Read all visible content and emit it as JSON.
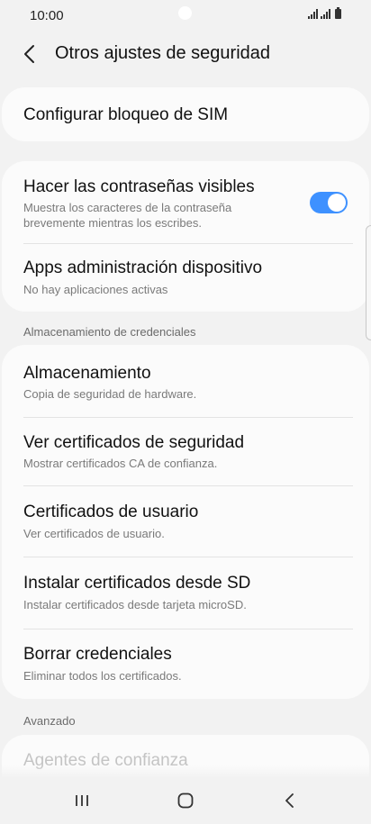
{
  "status_bar": {
    "time": "10:00"
  },
  "header": {
    "title": "Otros ajustes de seguridad",
    "back_icon": "chevron-left-icon"
  },
  "cards": {
    "sim": {
      "title": "Configurar bloqueo de SIM"
    },
    "passwords": {
      "title": "Hacer las contraseñas visibles",
      "subtitle_line1": "Muestra los caracteres de la contraseña",
      "subtitle_line2": "brevemente mientras los escribes.",
      "toggle_on": true
    },
    "device_admin": {
      "title": "Apps administración dispositivo",
      "subtitle": "No hay aplicaciones activas"
    }
  },
  "credentials_section": {
    "label": "Almacenamiento de credenciales",
    "items": [
      {
        "title": "Almacenamiento",
        "subtitle": "Copia de seguridad de hardware."
      },
      {
        "title": "Ver certificados de seguridad",
        "subtitle": "Mostrar certificados CA de confianza."
      },
      {
        "title": "Certificados de usuario",
        "subtitle": "Ver certificados de usuario."
      },
      {
        "title": "Instalar certificados desde SD",
        "subtitle": "Instalar certificados desde tarjeta microSD."
      },
      {
        "title": "Borrar credenciales",
        "subtitle": "Eliminar todos los certificados."
      }
    ]
  },
  "advanced_section": {
    "label": "Avanzado",
    "items": [
      {
        "title": "Agentes de confianza"
      }
    ]
  },
  "colors": {
    "accent": "#3e91ff",
    "background": "#f2f2f2",
    "card": "#fbfbfb"
  },
  "nav_bar": {
    "icons": [
      "recent-apps-icon",
      "home-icon",
      "back-icon"
    ]
  }
}
